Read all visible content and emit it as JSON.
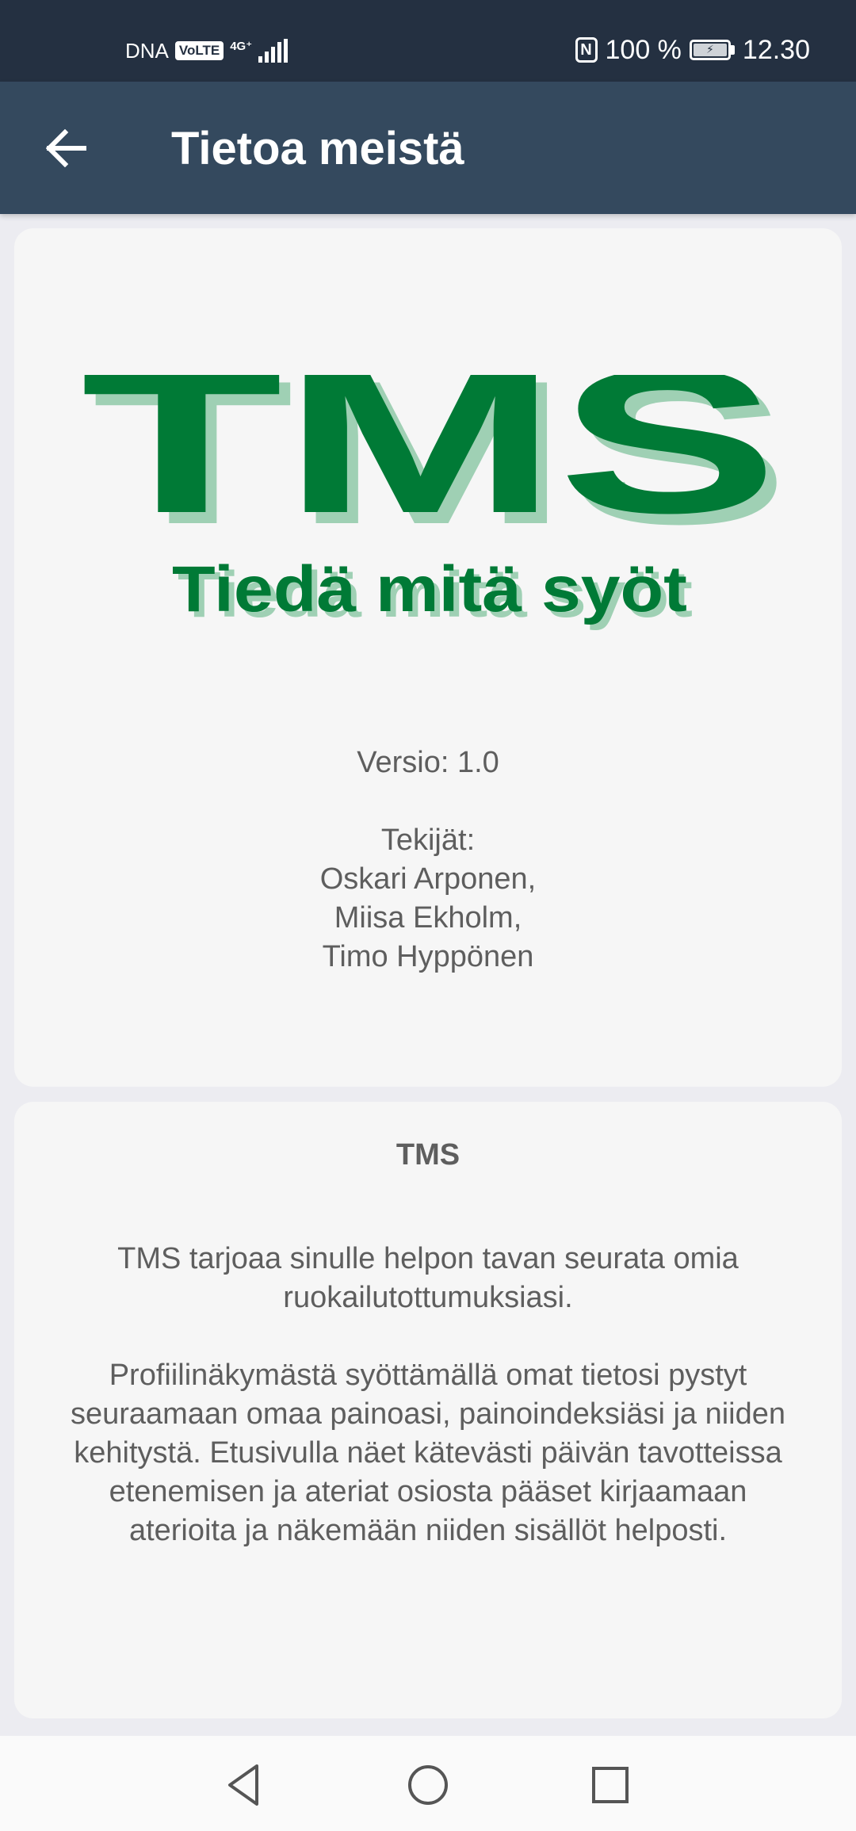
{
  "status_bar": {
    "carrier": "DNA",
    "volte_label": "VoLTE",
    "network_type": "4G⁺",
    "nfc_label": "N",
    "battery_percent": "100 %",
    "battery_level": 100,
    "time": "12.30"
  },
  "app_bar": {
    "title": "Tietoa meistä",
    "back_icon": "arrow-left-icon"
  },
  "logo": {
    "main_text": "TMS",
    "tagline": "Tiedä mitä syöt",
    "primary_color": "#007a36",
    "shadow_color": "#9fd0b4"
  },
  "info": {
    "version": "Versio: 1.0",
    "authors_label": "Tekijät:",
    "authors": [
      "Oskari Arponen,",
      "Miisa Ekholm,",
      "Timo Hyppönen"
    ]
  },
  "about": {
    "title": "TMS",
    "paragraph1": "TMS tarjoaa sinulle helpon tavan seurata omia ruokailutottumuksiasi.",
    "paragraph2": "Profiilinäkymästä syöttämällä omat tietosi pystyt seuraamaan omaa painoasi, painoindeksiäsi ja niiden kehitystä. Etusivulla näet kätevästi päivän tavotteissa etenemisen ja ateriat osiosta pääset kirjaamaan aterioita ja näkemään niiden sisällöt helposti."
  },
  "nav": {
    "back_icon": "triangle-back-icon",
    "home_icon": "circle-home-icon",
    "recents_icon": "square-recents-icon"
  },
  "colors": {
    "status_bar": "#243041",
    "app_bar": "#34495e",
    "background": "#ececf1",
    "card": "#f6f6f6",
    "text": "#5e5e5e"
  }
}
